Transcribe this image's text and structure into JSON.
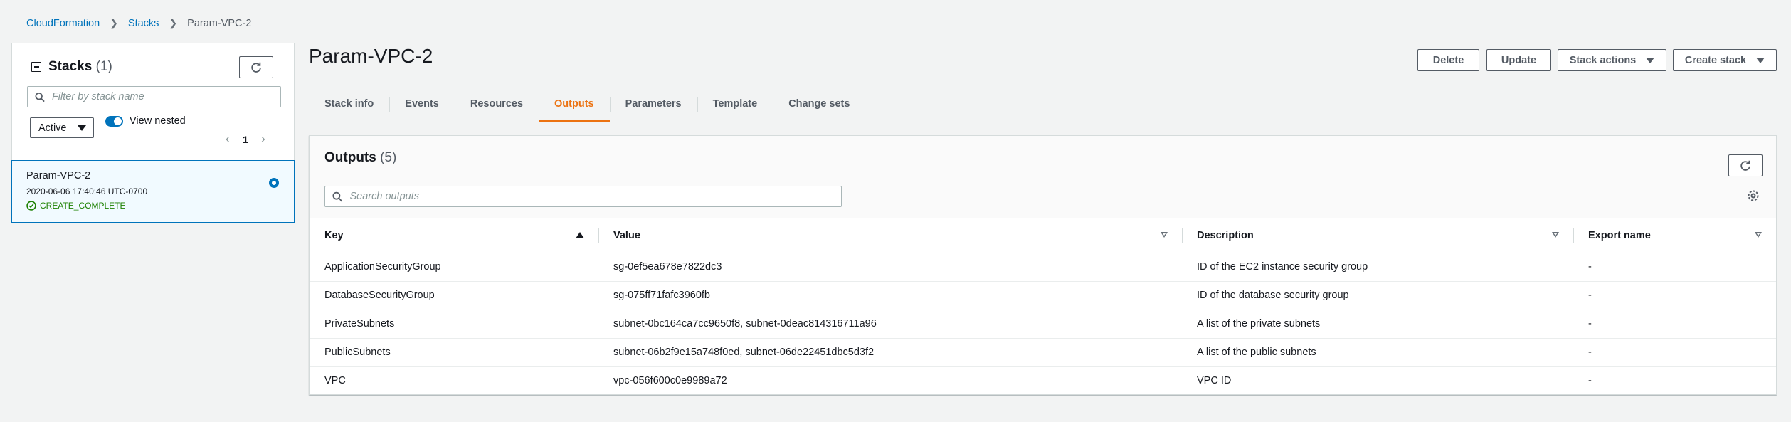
{
  "breadcrumb": [
    "CloudFormation",
    "Stacks",
    "Param-VPC-2"
  ],
  "stacks_panel": {
    "title": "Stacks",
    "count": "(1)",
    "filter_placeholder": "Filter by stack name",
    "status_filter": "Active",
    "view_nested_label": "View nested",
    "page": "1",
    "stack": {
      "name": "Param-VPC-2",
      "date": "2020-06-06 17:40:46 UTC-0700",
      "status": "CREATE_COMPLETE"
    }
  },
  "page_title": "Param-VPC-2",
  "actions": {
    "delete": "Delete",
    "update": "Update",
    "stack_actions": "Stack actions",
    "create_stack": "Create stack"
  },
  "tabs": [
    "Stack info",
    "Events",
    "Resources",
    "Outputs",
    "Parameters",
    "Template",
    "Change sets"
  ],
  "active_tab": "Outputs",
  "outputs": {
    "title": "Outputs",
    "count": "(5)",
    "search_placeholder": "Search outputs",
    "columns": [
      "Key",
      "Value",
      "Description",
      "Export name"
    ],
    "rows": [
      [
        "ApplicationSecurityGroup",
        "sg-0ef5ea678e7822dc3",
        "ID of the EC2 instance security group",
        "-"
      ],
      [
        "DatabaseSecurityGroup",
        "sg-075ff71fafc3960fb",
        "ID of the database security group",
        "-"
      ],
      [
        "PrivateSubnets",
        "subnet-0bc164ca7cc9650f8, subnet-0deac814316711a96",
        "A list of the private subnets",
        "-"
      ],
      [
        "PublicSubnets",
        "subnet-06b2f9e15a748f0ed, subnet-06de22451dbc5d3f2",
        "A list of the public subnets",
        "-"
      ],
      [
        "VPC",
        "vpc-056f600c0e9989a72",
        "VPC ID",
        "-"
      ]
    ]
  },
  "colors": {
    "link": "#0073bb",
    "accent": "#ec7211",
    "success": "#1d8102"
  }
}
